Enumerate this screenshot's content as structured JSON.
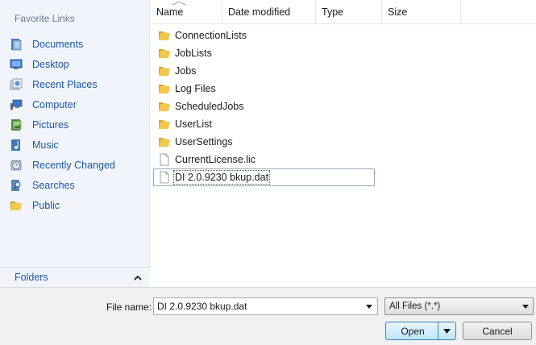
{
  "nav": {
    "header": "Favorite Links",
    "items": [
      {
        "label": "Documents",
        "icon": "documents-icon"
      },
      {
        "label": "Desktop",
        "icon": "desktop-icon"
      },
      {
        "label": "Recent Places",
        "icon": "recent-places-icon"
      },
      {
        "label": "Computer",
        "icon": "computer-icon"
      },
      {
        "label": "Pictures",
        "icon": "pictures-icon"
      },
      {
        "label": "Music",
        "icon": "music-icon"
      },
      {
        "label": "Recently Changed",
        "icon": "recently-changed-icon"
      },
      {
        "label": "Searches",
        "icon": "searches-icon"
      },
      {
        "label": "Public",
        "icon": "public-folder-icon"
      }
    ],
    "folders_label": "Folders"
  },
  "columns": {
    "name": "Name",
    "date_modified": "Date modified",
    "type": "Type",
    "size": "Size"
  },
  "files": [
    {
      "name": "ConnectionLists",
      "kind": "folder"
    },
    {
      "name": "JobLists",
      "kind": "folder"
    },
    {
      "name": "Jobs",
      "kind": "folder"
    },
    {
      "name": "Log Files",
      "kind": "folder"
    },
    {
      "name": "ScheduledJobs",
      "kind": "folder"
    },
    {
      "name": "UserList",
      "kind": "folder"
    },
    {
      "name": "UserSettings",
      "kind": "folder"
    },
    {
      "name": "CurrentLicense.lic",
      "kind": "file"
    },
    {
      "name": "DI 2.0.9230 bkup.dat",
      "kind": "file",
      "selected": true
    }
  ],
  "bottom": {
    "file_name_label": "File name:",
    "file_name_value": "DI 2.0.9230 bkup.dat",
    "file_type": "All Files (*.*)",
    "open_label": "Open",
    "cancel_label": "Cancel"
  },
  "colors": {
    "nav_bg": "#f1f5fb",
    "link": "#1e57a8",
    "folder": "#e8b83a",
    "open_border": "#3c7fb1"
  }
}
